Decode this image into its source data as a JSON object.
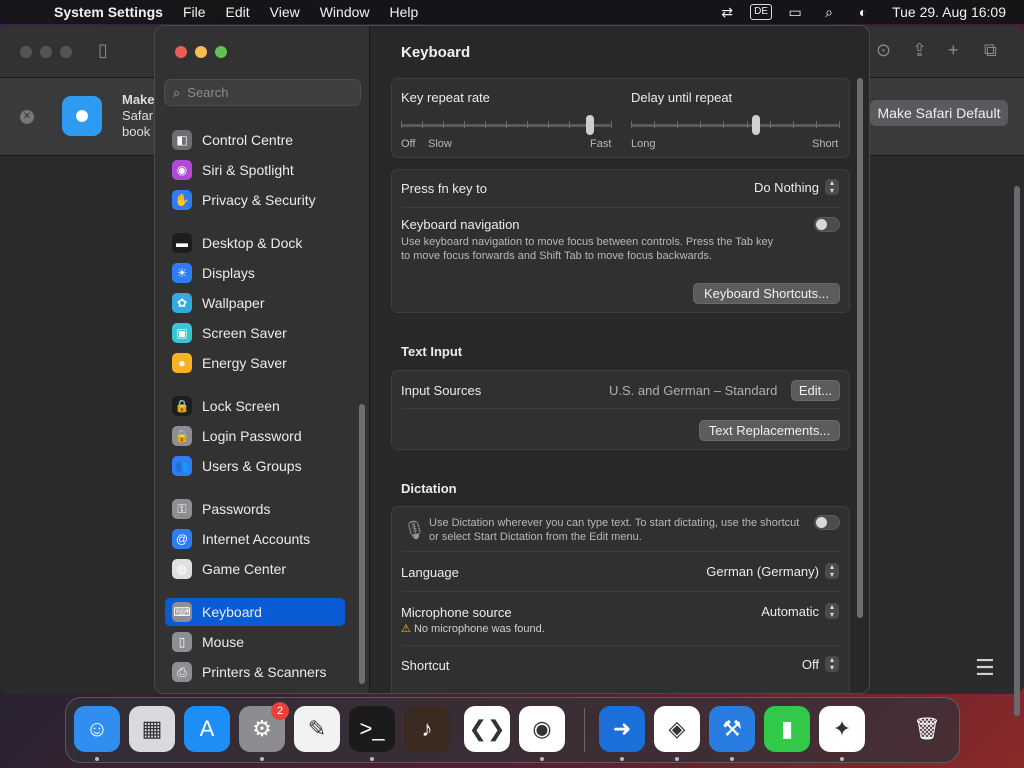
{
  "menubar": {
    "app_name": "System Settings",
    "menus": [
      "File",
      "Edit",
      "View",
      "Window",
      "Help"
    ],
    "input_source": "DE",
    "clock": "Tue 29. Aug  16:09"
  },
  "safari": {
    "banner_line1": "Make",
    "banner_line2": "Safar",
    "banner_line3": "book",
    "make_default_label": "Make Safari Default"
  },
  "sidebar": {
    "search_placeholder": "Search",
    "items": [
      {
        "label": "Control Centre",
        "icon": "control-centre-icon",
        "color": "#6e6e72"
      },
      {
        "label": "Siri & Spotlight",
        "icon": "siri-icon",
        "color": "#b04bd6"
      },
      {
        "label": "Privacy & Security",
        "icon": "hand-icon",
        "color": "#2f7df6"
      },
      {
        "label": "Desktop & Dock",
        "icon": "dock-icon",
        "color": "#1d1d1f"
      },
      {
        "label": "Displays",
        "icon": "sun-icon",
        "color": "#2f7df6"
      },
      {
        "label": "Wallpaper",
        "icon": "flower-icon",
        "color": "#35aadc"
      },
      {
        "label": "Screen Saver",
        "icon": "screen-saver-icon",
        "color": "#3ac3d6"
      },
      {
        "label": "Energy Saver",
        "icon": "bulb-icon",
        "color": "#f5b324"
      },
      {
        "label": "Lock Screen",
        "icon": "lock-icon",
        "color": "#1d1d1f"
      },
      {
        "label": "Login Password",
        "icon": "lock-icon",
        "color": "#8e8e93"
      },
      {
        "label": "Users & Groups",
        "icon": "users-icon",
        "color": "#2f7df6"
      },
      {
        "label": "Passwords",
        "icon": "key-icon",
        "color": "#8e8e93"
      },
      {
        "label": "Internet Accounts",
        "icon": "at-icon",
        "color": "#2f7df6"
      },
      {
        "label": "Game Center",
        "icon": "game-center-icon",
        "color": "#e0e0e0"
      },
      {
        "label": "Keyboard",
        "icon": "keyboard-icon",
        "color": "#8e8e93",
        "selected": true
      },
      {
        "label": "Mouse",
        "icon": "mouse-icon",
        "color": "#8e8e93"
      },
      {
        "label": "Printers & Scanners",
        "icon": "printer-icon",
        "color": "#8e8e93"
      }
    ]
  },
  "content": {
    "title": "Keyboard",
    "key_repeat": {
      "label": "Key repeat rate",
      "off": "Off",
      "slow": "Slow",
      "fast": "Fast",
      "value_fraction": 0.9
    },
    "delay_repeat": {
      "label": "Delay until repeat",
      "long": "Long",
      "short": "Short",
      "value_fraction": 0.6
    },
    "fn_key": {
      "label": "Press fn key to",
      "value": "Do Nothing"
    },
    "keyboard_nav": {
      "label": "Keyboard navigation",
      "desc1": "Use keyboard navigation to move focus between controls. Press the Tab key",
      "desc2": "to move focus forwards and Shift Tab to move focus backwards.",
      "enabled": false
    },
    "shortcuts_button": "Keyboard Shortcuts...",
    "text_input": {
      "title": "Text Input",
      "input_sources_label": "Input Sources",
      "input_sources_value": "U.S. and German – Standard",
      "edit_button": "Edit...",
      "replacements_button": "Text Replacements..."
    },
    "dictation": {
      "title": "Dictation",
      "desc1": "Use Dictation wherever you can type text. To start dictating, use the shortcut",
      "desc2": "or select Start Dictation from the Edit menu.",
      "enabled": false,
      "language_label": "Language",
      "language_value": "German (Germany)",
      "mic_label": "Microphone source",
      "mic_value": "Automatic",
      "mic_warning": "No microphone was found.",
      "shortcut_label": "Shortcut",
      "shortcut_value": "Off"
    }
  },
  "dock": {
    "apps": [
      {
        "name": "finder",
        "color": "#2f8ef0",
        "glyph": "☺"
      },
      {
        "name": "launchpad",
        "color": "#d9d9de",
        "glyph": "▦"
      },
      {
        "name": "app-store",
        "color": "#1c8ef6",
        "glyph": "A"
      },
      {
        "name": "system-settings",
        "color": "#8c8c90",
        "glyph": "⚙",
        "badge": "2"
      },
      {
        "name": "textedit",
        "color": "#f2f2f2",
        "glyph": "✎"
      },
      {
        "name": "terminal",
        "color": "#1b1b1b",
        "glyph": ">_"
      },
      {
        "name": "garageband",
        "color": "#3a2a20",
        "glyph": "♪"
      },
      {
        "name": "vscode",
        "color": "#ffffff",
        "glyph": "❮❯"
      },
      {
        "name": "chrome",
        "color": "#ffffff",
        "glyph": "◉"
      },
      {
        "name": "migration-assistant",
        "color": "#1a6fd8",
        "glyph": "➜"
      },
      {
        "name": "visual-studio",
        "color": "#ffffff",
        "glyph": "◈"
      },
      {
        "name": "xcode",
        "color": "#2a7de0",
        "glyph": "⚒"
      },
      {
        "name": "archive-utility",
        "color": "#32c84a",
        "glyph": "▮"
      },
      {
        "name": "safari",
        "color": "#ffffff",
        "glyph": "✦"
      },
      {
        "name": "trash",
        "color": "transparent",
        "glyph": "🗑"
      }
    ]
  }
}
